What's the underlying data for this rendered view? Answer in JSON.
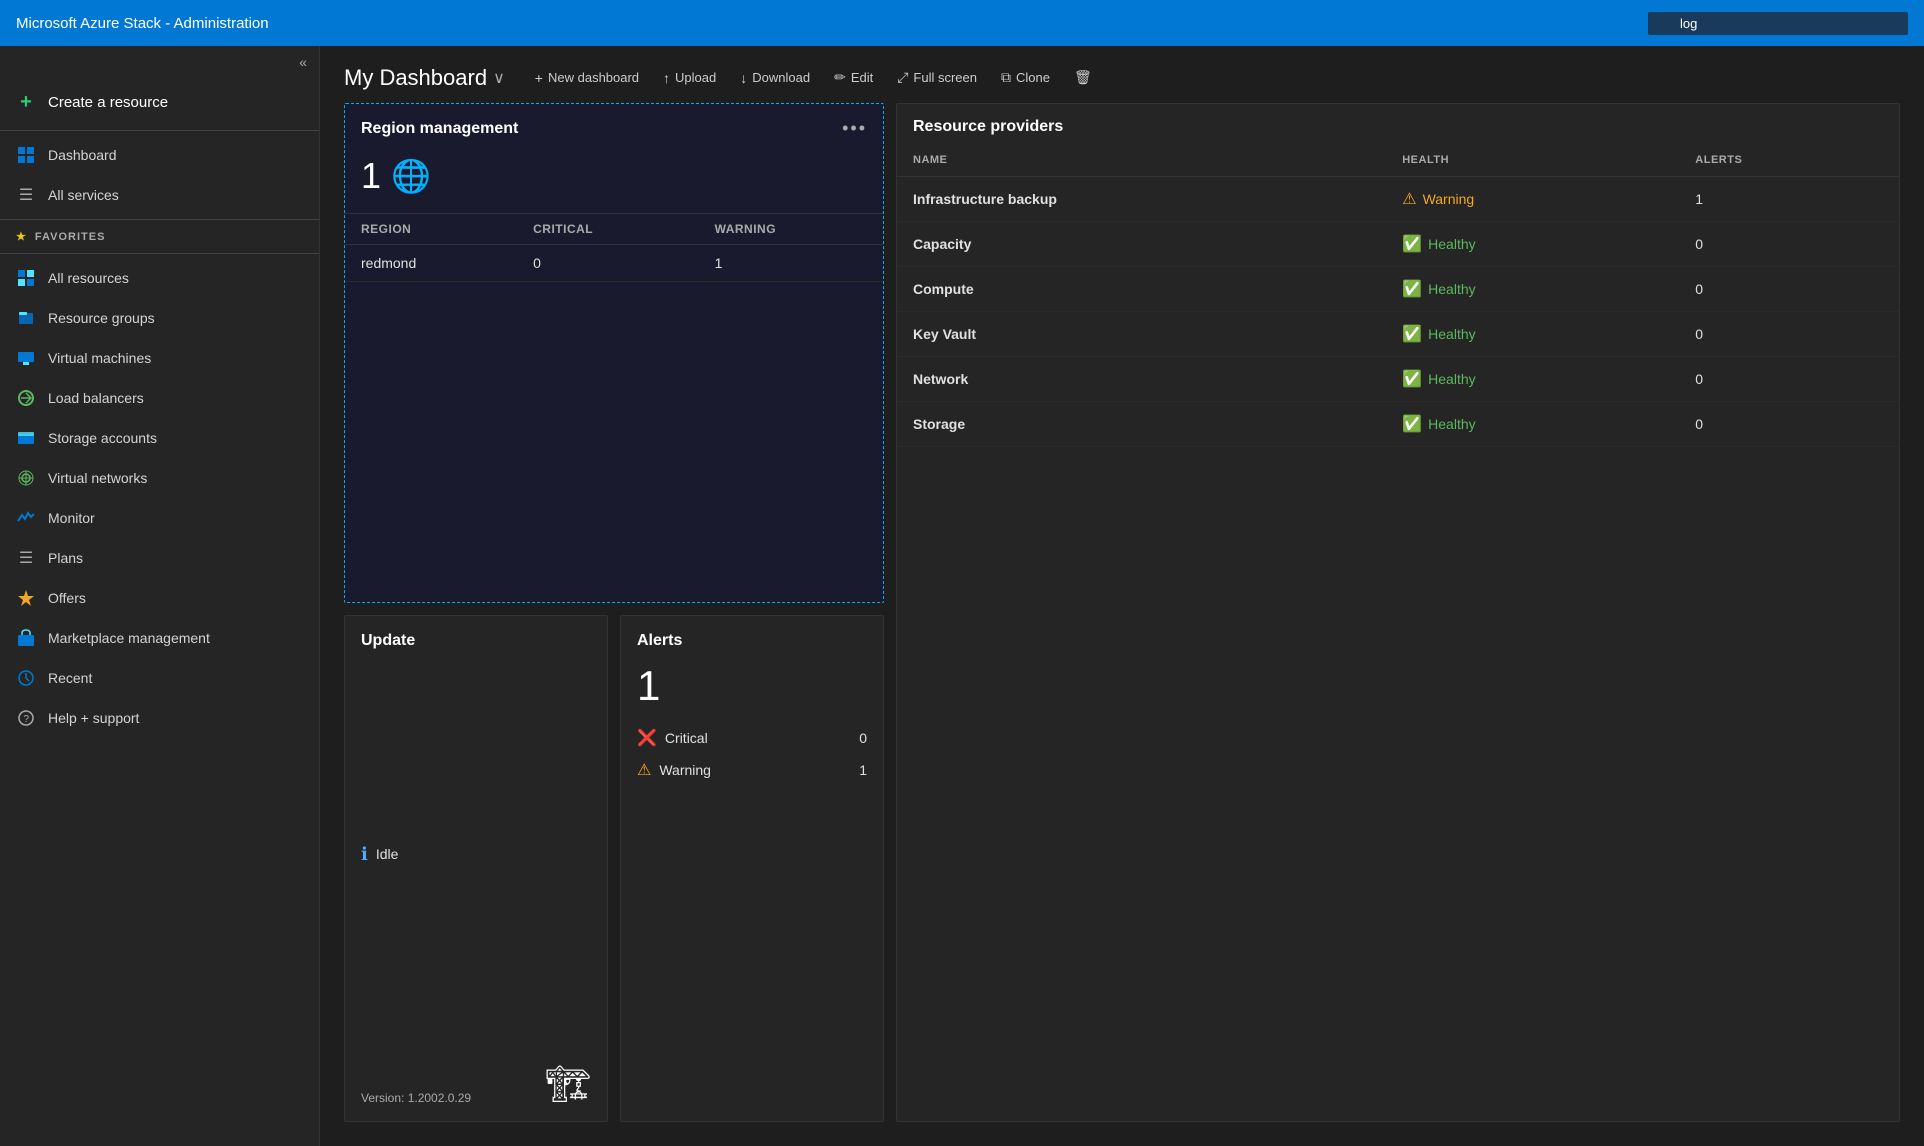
{
  "topbar": {
    "title": "Microsoft Azure Stack - Administration",
    "search_placeholder": "log",
    "search_value": "log"
  },
  "sidebar": {
    "collapse_icon": "«",
    "create_resource_label": "Create a resource",
    "nav_items": [
      {
        "id": "dashboard",
        "label": "Dashboard",
        "icon": "🗂"
      },
      {
        "id": "all-services",
        "label": "All services",
        "icon": "☰"
      }
    ],
    "favorites_label": "FAVORITES",
    "favorites_icon": "★",
    "favorite_items": [
      {
        "id": "all-resources",
        "label": "All resources",
        "icon": "⊞"
      },
      {
        "id": "resource-groups",
        "label": "Resource groups",
        "icon": "📦"
      },
      {
        "id": "virtual-machines",
        "label": "Virtual machines",
        "icon": "🖥"
      },
      {
        "id": "load-balancers",
        "label": "Load balancers",
        "icon": "⚖"
      },
      {
        "id": "storage-accounts",
        "label": "Storage accounts",
        "icon": "💾"
      },
      {
        "id": "virtual-networks",
        "label": "Virtual networks",
        "icon": "🌐"
      },
      {
        "id": "monitor",
        "label": "Monitor",
        "icon": "📊"
      },
      {
        "id": "plans",
        "label": "Plans",
        "icon": "☰"
      },
      {
        "id": "offers",
        "label": "Offers",
        "icon": "🏷"
      },
      {
        "id": "marketplace",
        "label": "Marketplace management",
        "icon": "🏪"
      },
      {
        "id": "recent",
        "label": "Recent",
        "icon": "🕐"
      },
      {
        "id": "help",
        "label": "Help + support",
        "icon": "🎫"
      }
    ]
  },
  "dashboard": {
    "title": "My Dashboard",
    "chevron": "∨",
    "actions": [
      {
        "id": "new-dashboard",
        "icon": "+",
        "label": "New dashboard"
      },
      {
        "id": "upload",
        "icon": "↑",
        "label": "Upload"
      },
      {
        "id": "download",
        "icon": "↓",
        "label": "Download"
      },
      {
        "id": "edit",
        "icon": "✏",
        "label": "Edit"
      },
      {
        "id": "fullscreen",
        "icon": "⤢",
        "label": "Full screen"
      },
      {
        "id": "clone",
        "icon": "⧉",
        "label": "Clone"
      },
      {
        "id": "delete",
        "icon": "🗑",
        "label": ""
      }
    ]
  },
  "region_tile": {
    "title": "Region management",
    "menu_icon": "•••",
    "count": "1",
    "globe_emoji": "🌐",
    "table_headers": [
      "REGION",
      "CRITICAL",
      "WARNING"
    ],
    "rows": [
      {
        "region": "redmond",
        "critical": "0",
        "warning": "1"
      }
    ]
  },
  "resource_providers_tile": {
    "title": "Resource providers",
    "headers": [
      "NAME",
      "HEALTH",
      "ALERTS"
    ],
    "rows": [
      {
        "name": "Infrastructure backup",
        "health": "Warning",
        "health_icon": "⚠",
        "health_color": "#f5a623",
        "alerts": "1"
      },
      {
        "name": "Capacity",
        "health": "Healthy",
        "health_icon": "✅",
        "health_color": "#5cb85c",
        "alerts": "0"
      },
      {
        "name": "Compute",
        "health": "Healthy",
        "health_icon": "✅",
        "health_color": "#5cb85c",
        "alerts": "0"
      },
      {
        "name": "Key Vault",
        "health": "Healthy",
        "health_icon": "✅",
        "health_color": "#5cb85c",
        "alerts": "0"
      },
      {
        "name": "Network",
        "health": "Healthy",
        "health_icon": "✅",
        "health_color": "#5cb85c",
        "alerts": "0"
      },
      {
        "name": "Storage",
        "health": "Healthy",
        "health_icon": "✅",
        "health_color": "#5cb85c",
        "alerts": "0"
      }
    ]
  },
  "update_tile": {
    "title": "Update",
    "status_icon": "ℹ",
    "status_text": "Idle",
    "version_label": "Version: 1.2002.0.29",
    "illustration": "🏗"
  },
  "alerts_tile": {
    "title": "Alerts",
    "total_count": "1",
    "items": [
      {
        "icon": "❌",
        "label": "Critical",
        "count": "0",
        "color": "#d9534f"
      },
      {
        "icon": "⚠",
        "label": "Warning",
        "count": "1",
        "color": "#f5a623"
      }
    ]
  }
}
